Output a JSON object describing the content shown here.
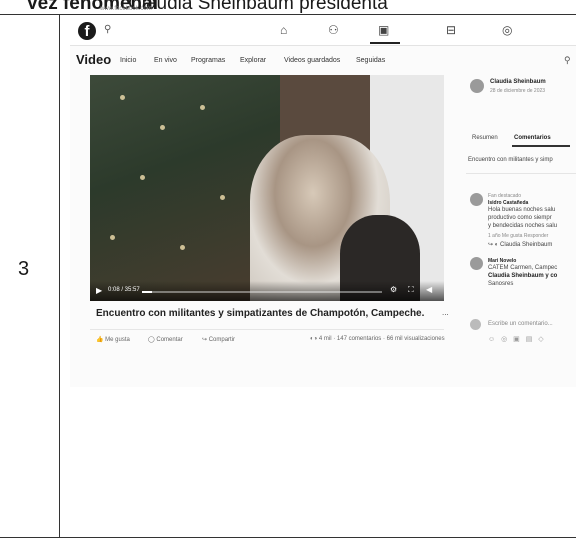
{
  "doc": {
    "header_bold": "Vez fenomenal",
    "header_rest": "Claudia Sheinbaum presidenta",
    "url": "www.facebook.com",
    "row_number": "3"
  },
  "nav": {
    "search_icon": "search-icon",
    "icons": [
      "home-icon",
      "friends-icon",
      "video-icon",
      "marketplace-icon",
      "gaming-icon"
    ]
  },
  "video_header": {
    "title": "Video",
    "tabs": [
      "Inicio",
      "En vivo",
      "Programas",
      "Explorar",
      "Videos guardados",
      "Seguidas"
    ]
  },
  "player": {
    "time": "0:08 / 35:57",
    "progress": 0.04
  },
  "post": {
    "caption": "Encuentro con militantes y simpatizantes de Champotón, Campeche.",
    "more": "...",
    "actions": [
      "Me gusta",
      "Comentar",
      "Compartir"
    ],
    "stats": "4 mil · 147 comentarios · 66 mil visualizaciones"
  },
  "sidebar": {
    "author": "Claudia Sheinbaum",
    "date": "28 de diciembre de 2023",
    "tabs": [
      "Resumen",
      "Comentarios"
    ],
    "description": "Encuentro con militantes y simp",
    "comment1": {
      "badge": "Fan destacado",
      "name": "Isidro Castañeda",
      "lines": [
        "Hola buenas noches salu",
        "productivo como siempr",
        "y bendecidas noches salu"
      ],
      "meta": "1 año   Me gusta   Responder",
      "reply": "Claudia Sheinbaum"
    },
    "comment2": {
      "name": "Mari Novelo",
      "lines": [
        "CATEM Carmen, Campec",
        "Claudia Sheinbaum y co",
        "Sanosres"
      ]
    },
    "input_placeholder": "Escribe un comentario...",
    "input_icons": "☺ ◎ ▣ ▤ ◇"
  },
  "colors": {
    "accent": "#1b1b1b",
    "text": "#1a1a1a"
  }
}
